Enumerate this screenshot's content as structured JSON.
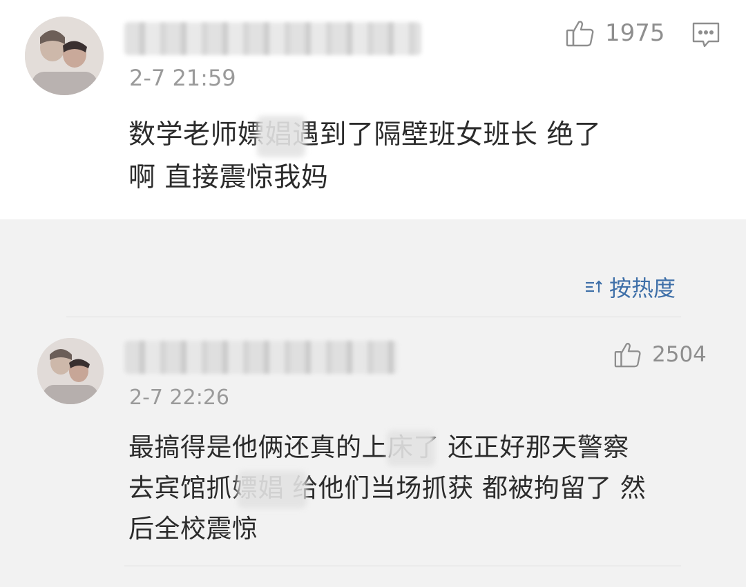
{
  "comments": [
    {
      "timestamp": "2-7 21:59",
      "likes": "1975",
      "text_line1": "数学老师嫖娼遇到了隔壁班女班长 绝了",
      "text_line2": "啊 直接震惊我妈"
    },
    {
      "timestamp": "2-7 22:26",
      "likes": "2504",
      "text_line1": "最搞得是他俩还真的上床了 还正好那天警察",
      "text_line2": "去宾馆抓嫖娼 给他们当场抓获 都被拘留了 然",
      "text_line3": "后全校震惊"
    }
  ],
  "sort": {
    "label": "按热度",
    "icon": "sort-icon"
  },
  "icons": {
    "like": "thumbs-up-icon",
    "reply": "comment-icon"
  },
  "colors": {
    "accent": "#3e6fa8",
    "muted": "#9a9a9a",
    "text": "#2b2b2b"
  }
}
